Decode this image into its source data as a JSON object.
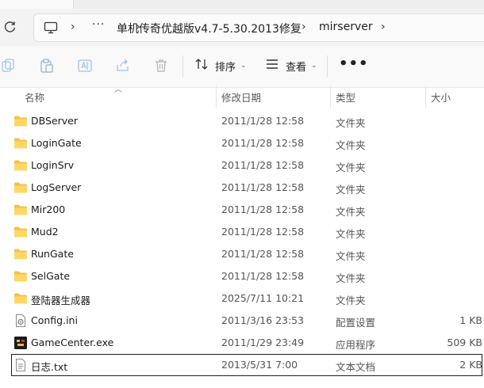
{
  "breadcrumb": {
    "overflow": "···",
    "items": [
      "单机传奇优越版v4.7-5.30.2013修复",
      "mirserver"
    ]
  },
  "toolbar": {
    "sort_label": "排序",
    "view_label": "查看",
    "more_label": "•••"
  },
  "columns": {
    "name": "名称",
    "date": "修改日期",
    "type": "类型",
    "size": "大小"
  },
  "files": [
    {
      "name": "DBServer",
      "date": "2011/1/28 12:58",
      "type": "文件夹",
      "size": "",
      "icon": "folder-icon"
    },
    {
      "name": "LoginGate",
      "date": "2011/1/28 12:58",
      "type": "文件夹",
      "size": "",
      "icon": "folder-icon"
    },
    {
      "name": "LoginSrv",
      "date": "2011/1/28 12:58",
      "type": "文件夹",
      "size": "",
      "icon": "folder-icon"
    },
    {
      "name": "LogServer",
      "date": "2011/1/28 12:58",
      "type": "文件夹",
      "size": "",
      "icon": "folder-icon"
    },
    {
      "name": "Mir200",
      "date": "2011/1/28 12:58",
      "type": "文件夹",
      "size": "",
      "icon": "folder-icon"
    },
    {
      "name": "Mud2",
      "date": "2011/1/28 12:58",
      "type": "文件夹",
      "size": "",
      "icon": "folder-icon"
    },
    {
      "name": "RunGate",
      "date": "2011/1/28 12:58",
      "type": "文件夹",
      "size": "",
      "icon": "folder-icon"
    },
    {
      "name": "SelGate",
      "date": "2011/1/28 12:58",
      "type": "文件夹",
      "size": "",
      "icon": "folder-icon"
    },
    {
      "name": "登陆器生成器",
      "date": "2025/7/11 10:21",
      "type": "文件夹",
      "size": "",
      "icon": "folder-icon"
    },
    {
      "name": "Config.ini",
      "date": "2011/3/16 23:53",
      "type": "配置设置",
      "size": "1 KB",
      "icon": "settings-file-icon"
    },
    {
      "name": "GameCenter.exe",
      "date": "2011/1/29 23:49",
      "type": "应用程序",
      "size": "509 KB",
      "icon": "app-icon"
    },
    {
      "name": "日志.txt",
      "date": "2013/5/31 7:00",
      "type": "文本文档",
      "size": "2 KB",
      "icon": "text-file-icon",
      "selected": true
    }
  ]
}
